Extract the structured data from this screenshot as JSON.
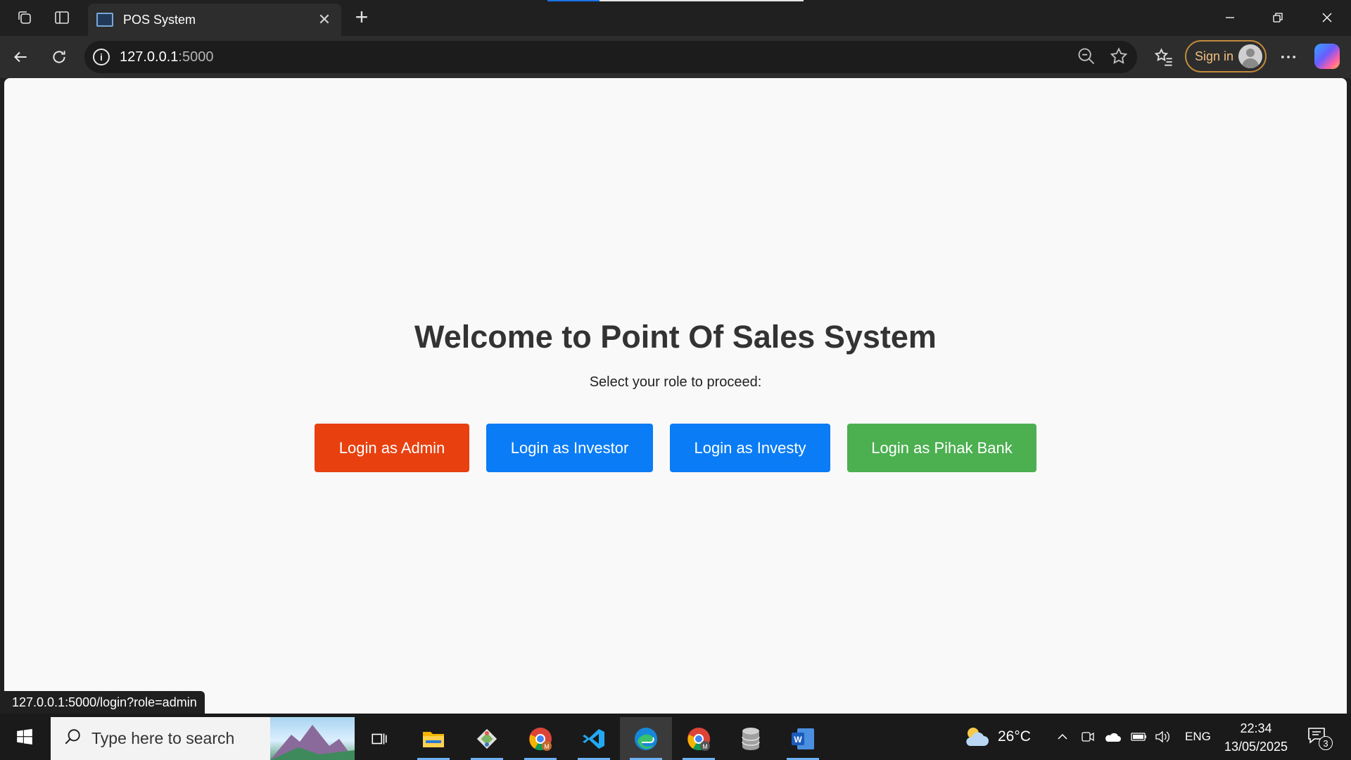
{
  "browser": {
    "tab_title": "POS System",
    "url_host": "127.0.0.1",
    "url_port": ":5000",
    "signin_label": "Sign in"
  },
  "page": {
    "heading": "Welcome to Point Of Sales System",
    "subheading": "Select your role to proceed:",
    "buttons": [
      {
        "label": "Login as Admin",
        "color": "#e8400f"
      },
      {
        "label": "Login as Investor",
        "color": "#0a7cf5"
      },
      {
        "label": "Login as Investy",
        "color": "#0a7cf5"
      },
      {
        "label": "Login as Pihak Bank",
        "color": "#4caf50"
      }
    ],
    "status_url": "127.0.0.1:5000/login?role=admin"
  },
  "taskbar": {
    "search_placeholder": "Type here to search",
    "apps": [
      "file-explorer-icon",
      "git-icon",
      "chrome-icon",
      "vscode-icon",
      "edge-icon",
      "chrome-profile-icon",
      "database-icon",
      "word-icon"
    ],
    "weather_temp": "26°C",
    "language": "ENG",
    "time": "22:34",
    "date": "13/05/2025",
    "notification_count": "3"
  }
}
